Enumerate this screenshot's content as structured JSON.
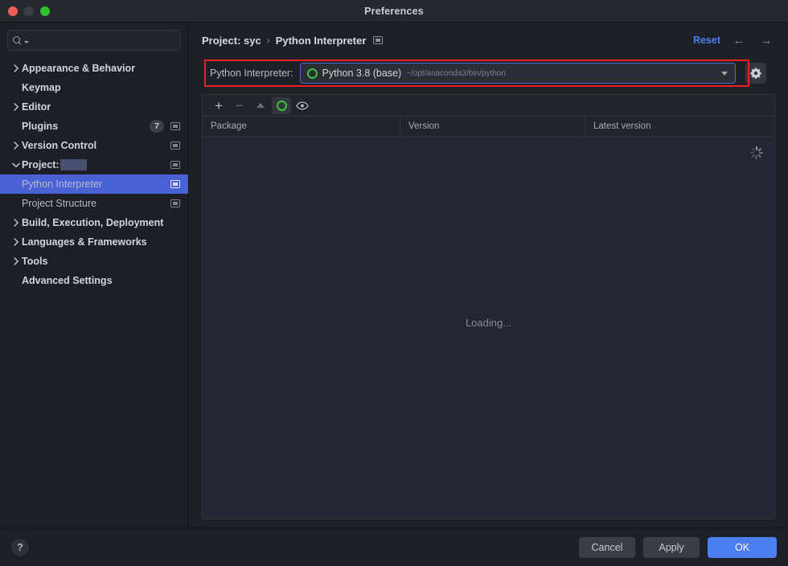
{
  "window": {
    "title": "Preferences",
    "traffic_lights": [
      "close",
      "minimize",
      "maximize"
    ]
  },
  "sidebar": {
    "search": {
      "placeholder": "",
      "value": ""
    },
    "items": [
      {
        "label": "Appearance & Behavior",
        "arrow": "collapsed",
        "level": 0,
        "bold": true,
        "badge": null,
        "scope_icon": false
      },
      {
        "label": "Keymap",
        "arrow": "none",
        "level": 0,
        "bold": true,
        "badge": null,
        "scope_icon": false
      },
      {
        "label": "Editor",
        "arrow": "collapsed",
        "level": 0,
        "bold": true,
        "badge": null,
        "scope_icon": false
      },
      {
        "label": "Plugins",
        "arrow": "none",
        "level": 0,
        "bold": true,
        "badge": "7",
        "scope_icon": true
      },
      {
        "label": "Version Control",
        "arrow": "collapsed",
        "level": 0,
        "bold": true,
        "badge": null,
        "scope_icon": true
      },
      {
        "label": "Project:",
        "arrow": "expanded",
        "level": 0,
        "bold": true,
        "badge": null,
        "scope_icon": true,
        "redacted": true
      },
      {
        "label": "Python Interpreter",
        "arrow": "none",
        "level": 1,
        "bold": false,
        "badge": null,
        "scope_icon": true,
        "selected": true
      },
      {
        "label": "Project Structure",
        "arrow": "none",
        "level": 1,
        "bold": false,
        "badge": null,
        "scope_icon": true
      },
      {
        "label": "Build, Execution, Deployment",
        "arrow": "collapsed",
        "level": 0,
        "bold": true,
        "badge": null,
        "scope_icon": false
      },
      {
        "label": "Languages & Frameworks",
        "arrow": "collapsed",
        "level": 0,
        "bold": true,
        "badge": null,
        "scope_icon": false
      },
      {
        "label": "Tools",
        "arrow": "collapsed",
        "level": 0,
        "bold": true,
        "badge": null,
        "scope_icon": false
      },
      {
        "label": "Advanced Settings",
        "arrow": "none",
        "level": 0,
        "bold": true,
        "badge": null,
        "scope_icon": false
      }
    ]
  },
  "header": {
    "breadcrumb_project": "Project: syc",
    "breadcrumb_sep": "›",
    "breadcrumb_page": "Python Interpreter",
    "reset_label": "Reset",
    "back_arrow": "←",
    "forward_arrow": "→"
  },
  "interpreter": {
    "label": "Python Interpreter:",
    "selected_name": "Python 3.8 (base)",
    "selected_path": "~/opt/anaconda3/bin/python",
    "highlight_color": "#ef1f1f",
    "focus_border_color": "#4b6cc9",
    "conda_color": "#3fc43f",
    "gear_icon": "gear-icon"
  },
  "packages": {
    "toolbar": [
      {
        "name": "add-package-button",
        "glyph": "+"
      },
      {
        "name": "remove-package-button",
        "glyph": "−"
      },
      {
        "name": "upgrade-package-button",
        "glyph": "▲"
      },
      {
        "name": "conda-toggle-button",
        "glyph": "conda-ring-icon"
      },
      {
        "name": "show-early-releases-button",
        "glyph": "eye-icon"
      }
    ],
    "columns": [
      "Package",
      "Version",
      "Latest version"
    ],
    "rows": [],
    "loading_text": "Loading...",
    "spinner_visible": true
  },
  "footer": {
    "help_label": "?",
    "cancel_label": "Cancel",
    "apply_label": "Apply",
    "ok_label": "OK",
    "ok_color": "#4b7ff0"
  }
}
